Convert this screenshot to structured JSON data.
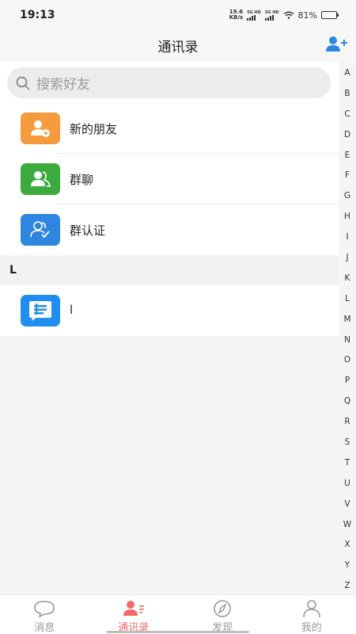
{
  "status_bar": {
    "time": "19:13",
    "net_speed_value": "19.6",
    "net_speed_unit": "KB/s",
    "sim1": "5G HD",
    "sim2": "5G HD",
    "battery": "81%",
    "battery_level": 0.81
  },
  "header": {
    "title": "通讯录",
    "add_icon": "add-contact-icon"
  },
  "search": {
    "placeholder": "搜索好友"
  },
  "list": {
    "items": [
      {
        "label": "新的朋友",
        "icon": "new-friend-icon",
        "color": "#f59a3d"
      },
      {
        "label": "群聊",
        "icon": "group-chat-icon",
        "color": "#3aab3c"
      },
      {
        "label": "群认证",
        "icon": "group-verify-icon",
        "color": "#2f86e0"
      }
    ]
  },
  "section": {
    "letter": "L"
  },
  "contact": {
    "name": "l",
    "avatar_color": "#1f8ef0"
  },
  "index_letters": [
    "A",
    "B",
    "C",
    "D",
    "E",
    "F",
    "G",
    "H",
    "I",
    "J",
    "K",
    "L",
    "M",
    "N",
    "O",
    "P",
    "Q",
    "R",
    "S",
    "T",
    "U",
    "V",
    "W",
    "X",
    "Y",
    "Z"
  ],
  "tabs": [
    {
      "label": "消息",
      "icon": "chat-bubble-icon",
      "active": false
    },
    {
      "label": "通讯录",
      "icon": "contacts-icon",
      "active": true
    },
    {
      "label": "发现",
      "icon": "compass-icon",
      "active": false
    },
    {
      "label": "我的",
      "icon": "profile-icon",
      "active": false
    }
  ],
  "colors": {
    "accent": "#f16a6a",
    "link_blue": "#2f86e0"
  }
}
